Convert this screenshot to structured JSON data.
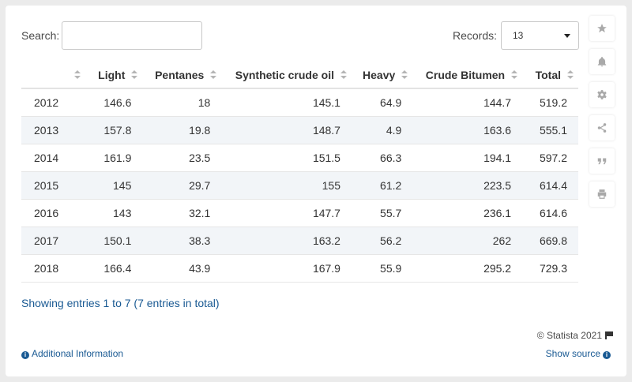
{
  "search": {
    "label": "Search:",
    "value": ""
  },
  "records": {
    "label": "Records:",
    "selected": "13"
  },
  "table": {
    "headers": [
      "",
      "Light",
      "Pentanes",
      "Synthetic crude oil",
      "Heavy",
      "Crude Bitumen",
      "Total"
    ],
    "rows": [
      [
        "2012",
        "146.6",
        "18",
        "145.1",
        "64.9",
        "144.7",
        "519.2"
      ],
      [
        "2013",
        "157.8",
        "19.8",
        "148.7",
        "4.9",
        "163.6",
        "555.1"
      ],
      [
        "2014",
        "161.9",
        "23.5",
        "151.5",
        "66.3",
        "194.1",
        "597.2"
      ],
      [
        "2015",
        "145",
        "29.7",
        "155",
        "61.2",
        "223.5",
        "614.4"
      ],
      [
        "2016",
        "143",
        "32.1",
        "147.7",
        "55.7",
        "236.1",
        "614.6"
      ],
      [
        "2017",
        "150.1",
        "38.3",
        "163.2",
        "56.2",
        "262",
        "669.8"
      ],
      [
        "2018",
        "166.4",
        "43.9",
        "167.9",
        "55.9",
        "295.2",
        "729.3"
      ]
    ]
  },
  "footer": {
    "showing": "Showing entries 1 to 7 (7 entries in total)",
    "copyright": "© Statista 2021",
    "additional_info": "Additional Information",
    "show_source": "Show source"
  },
  "sidebar": {
    "icons": [
      "star-icon",
      "bell-icon",
      "gear-icon",
      "share-icon",
      "quote-icon",
      "print-icon"
    ]
  },
  "colors": {
    "link": "#1a5a93",
    "row_alt": "#f2f5f8",
    "icon": "#a9a9a9"
  }
}
